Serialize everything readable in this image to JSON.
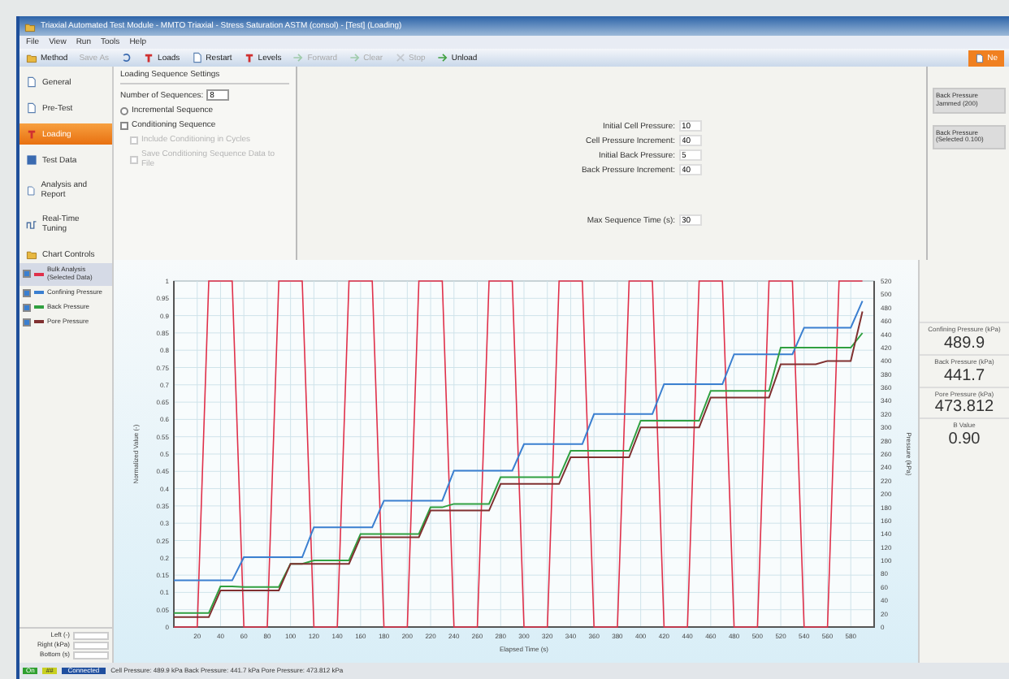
{
  "window": {
    "title": "Triaxial Automated Test Module - MMTO Triaxial - Stress Saturation ASTM (consol) - [Test] (Loading)"
  },
  "menu": [
    "File",
    "View",
    "Run",
    "Tools",
    "Help"
  ],
  "toolbar": [
    {
      "label": "Method",
      "kind": "folder",
      "disabled": false
    },
    {
      "label": "Save As",
      "kind": "plain",
      "disabled": true
    },
    {
      "kind": "undo",
      "disabled": false
    },
    {
      "label": "Loads",
      "kind": "bar",
      "disabled": false
    },
    {
      "label": "Restart",
      "kind": "page",
      "disabled": false
    },
    {
      "label": "Levels",
      "kind": "bar",
      "disabled": false
    },
    {
      "label": "Forward",
      "kind": "arrow",
      "disabled": true
    },
    {
      "label": "Clear",
      "kind": "arrow",
      "disabled": true
    },
    {
      "label": "Stop",
      "kind": "cross",
      "disabled": true
    },
    {
      "label": "Unload",
      "kind": "arrow",
      "disabled": false
    }
  ],
  "action_button": {
    "label": "Ne"
  },
  "nav": [
    {
      "label": "General",
      "kind": "page",
      "selected": false
    },
    {
      "label": "Pre-Test",
      "kind": "page",
      "selected": false
    },
    {
      "label": "Loading",
      "kind": "bar",
      "selected": true
    },
    {
      "label": "Test Data",
      "kind": "grid",
      "selected": false
    },
    {
      "label": "Analysis and Report",
      "kind": "page",
      "selected": false
    },
    {
      "label": "Real-Time Tuning",
      "kind": "wave",
      "selected": false
    },
    {
      "label": "Chart Controls",
      "kind": "folder",
      "selected": false
    }
  ],
  "settings": {
    "title": "Loading Sequence Settings",
    "sequences": {
      "label": "Number of Sequences:",
      "value": "8"
    },
    "options": [
      {
        "kind": "radio",
        "label": "Incremental Sequence",
        "checked": false,
        "disabled": false
      },
      {
        "kind": "checkbox",
        "label": "Conditioning Sequence",
        "checked": false,
        "disabled": false,
        "children": [
          {
            "kind": "checkbox",
            "label": "Include Conditioning in Cycles",
            "checked": false,
            "disabled": true
          },
          {
            "kind": "checkbox",
            "label": "Save Conditioning Sequence Data to File",
            "checked": false,
            "disabled": true
          }
        ]
      }
    ]
  },
  "pressure_fields": [
    {
      "label": "Initial Cell Pressure:",
      "value": "10"
    },
    {
      "label": "Cell Pressure Increment:",
      "value": "40"
    },
    {
      "label": "Initial Back Pressure:",
      "value": "5"
    },
    {
      "label": "Back Pressure Increment:",
      "value": "40"
    }
  ],
  "time_fields": [
    {
      "label": "Max Sequence Time (s):",
      "value": "30"
    }
  ],
  "right_buttons": [
    "Back Pressure Jammed (200)",
    "Back Pressure (Selected 0.100)"
  ],
  "legend": [
    {
      "checked": true,
      "selected": true
    },
    {
      "checked": true,
      "selected": false
    },
    {
      "checked": true,
      "selected": false
    },
    {
      "checked": true,
      "selected": false
    }
  ],
  "axis_fields": [
    "Left (-)",
    "Right (kPa)",
    "Bottom (s)"
  ],
  "chart": {
    "chart_data": {
      "type": "line",
      "xlabel": "Elapsed Time (s)",
      "ylabel": "Normalized Value (-)",
      "y2label": "Pressure (kPa)",
      "grid": true,
      "xlim": [
        0,
        600
      ],
      "ylim": [
        0,
        1
      ],
      "y2lim": [
        0,
        520
      ],
      "xticks": [
        20,
        40,
        60,
        80,
        100,
        120,
        140,
        160,
        180,
        200,
        220,
        240,
        260,
        280,
        300,
        320,
        340,
        360,
        380,
        400,
        420,
        440,
        460,
        480,
        500,
        520,
        540,
        560,
        580
      ],
      "yticks": [
        0,
        0.05,
        0.1,
        0.15,
        0.2,
        0.25,
        0.3,
        0.35,
        0.4,
        0.45,
        0.5,
        0.55,
        0.6,
        0.65,
        0.7,
        0.75,
        0.8,
        0.85,
        0.9,
        0.95,
        1
      ],
      "y2ticks": [
        0,
        20,
        40,
        60,
        80,
        100,
        120,
        140,
        160,
        180,
        200,
        220,
        240,
        260,
        280,
        300,
        320,
        340,
        360,
        380,
        400,
        420,
        440,
        460,
        480,
        500,
        520
      ],
      "x": [
        0,
        10,
        20,
        30,
        40,
        50,
        60,
        70,
        80,
        90,
        100,
        110,
        120,
        130,
        140,
        150,
        160,
        170,
        180,
        190,
        200,
        210,
        220,
        230,
        240,
        250,
        260,
        270,
        280,
        290,
        300,
        310,
        320,
        330,
        340,
        350,
        360,
        370,
        380,
        390,
        400,
        410,
        420,
        430,
        440,
        450,
        460,
        470,
        480,
        490,
        500,
        510,
        520,
        530,
        540,
        550,
        560,
        570,
        580,
        590
      ],
      "series": [
        {
          "name": "Bulk Analysis (Selected Data)",
          "color": "#e0304a",
          "values": [
            0,
            0,
            0,
            1,
            1,
            1,
            0,
            0,
            0,
            1,
            1,
            1,
            0,
            0,
            0,
            1,
            1,
            1,
            0,
            0,
            0,
            1,
            1,
            1,
            0,
            0,
            0,
            1,
            1,
            1,
            0,
            0,
            0,
            1,
            1,
            1,
            0,
            0,
            0,
            1,
            1,
            1,
            0,
            0,
            0,
            1,
            1,
            1,
            0,
            0,
            0,
            1,
            1,
            1,
            0,
            0,
            0,
            1,
            1,
            1
          ]
        },
        {
          "name": "Confining Pressure",
          "color": "#3a7fd0",
          "axis": "y2",
          "values": [
            70,
            70,
            70,
            70,
            70,
            70,
            105,
            105,
            105,
            105,
            105,
            105,
            150,
            150,
            150,
            150,
            150,
            150,
            190,
            190,
            190,
            190,
            190,
            190,
            235,
            235,
            235,
            235,
            235,
            235,
            275,
            275,
            275,
            275,
            275,
            275,
            320,
            320,
            320,
            320,
            320,
            320,
            365,
            365,
            365,
            365,
            365,
            365,
            410,
            410,
            410,
            410,
            410,
            410,
            450,
            450,
            450,
            450,
            450,
            490
          ]
        },
        {
          "name": "Back Pressure",
          "color": "#30a040",
          "axis": "y2",
          "values": [
            21,
            21,
            21,
            21,
            61,
            61,
            60,
            60,
            60,
            60,
            95,
            95,
            100,
            100,
            100,
            100,
            140,
            140,
            140,
            140,
            140,
            140,
            180,
            180,
            185,
            185,
            185,
            185,
            225,
            225,
            225,
            225,
            225,
            225,
            265,
            265,
            265,
            265,
            265,
            265,
            310,
            310,
            310,
            310,
            310,
            310,
            355,
            355,
            355,
            355,
            355,
            355,
            420,
            420,
            420,
            420,
            420,
            420,
            420,
            442
          ]
        },
        {
          "name": "Pore Pressure",
          "color": "#803030",
          "axis": "y2",
          "values": [
            15,
            15,
            15,
            15,
            55,
            55,
            55,
            55,
            55,
            55,
            95,
            95,
            95,
            95,
            95,
            95,
            135,
            135,
            135,
            135,
            135,
            135,
            175,
            175,
            175,
            175,
            175,
            175,
            215,
            215,
            215,
            215,
            215,
            215,
            255,
            255,
            255,
            255,
            255,
            255,
            300,
            300,
            300,
            300,
            300,
            300,
            345,
            345,
            345,
            345,
            345,
            345,
            395,
            395,
            395,
            395,
            400,
            400,
            400,
            474
          ]
        }
      ]
    }
  },
  "readouts": [
    {
      "label": "Confining Pressure (kPa)",
      "value": "489.9"
    },
    {
      "label": "Back Pressure (kPa)",
      "value": "441.7"
    },
    {
      "label": "Pore Pressure (kPa)",
      "value": "473.812"
    },
    {
      "label": "B Value",
      "value": "0.90"
    }
  ],
  "status_bar": {
    "indicator": "On",
    "count": "##",
    "mode": "Connected",
    "message": "Cell Pressure: 489.9 kPa  Back Pressure: 441.7 kPa  Pore Pressure: 473.812 kPa"
  }
}
